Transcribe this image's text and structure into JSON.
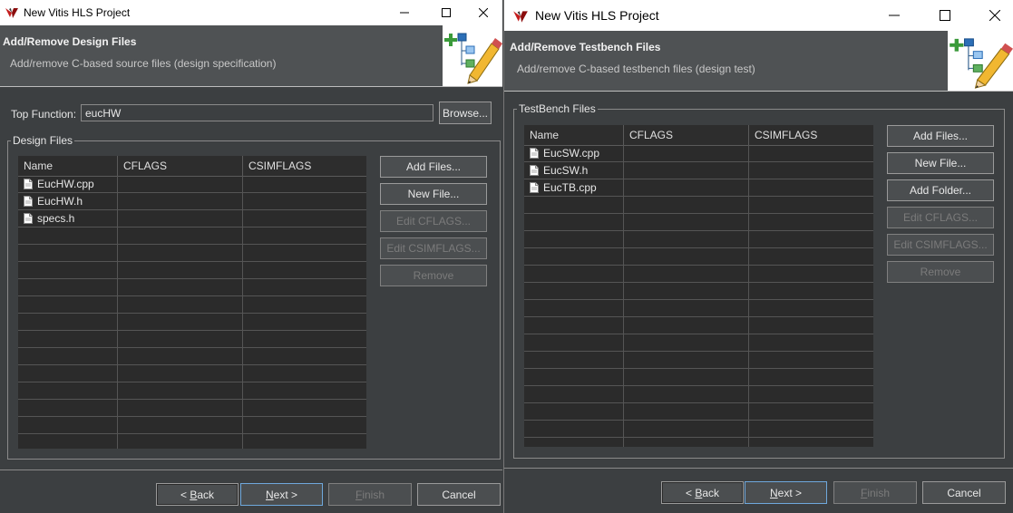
{
  "left": {
    "window_title": "New Vitis HLS Project",
    "header_title": "Add/Remove Design Files",
    "header_subtitle": "Add/remove C-based source files (design specification)",
    "top_function_label": "Top Function:",
    "top_function_value": "eucHW",
    "browse_label": "Browse...",
    "group_title": "Design Files",
    "columns": [
      "Name",
      "CFLAGS",
      "CSIMFLAGS"
    ],
    "files": [
      "EucHW.cpp",
      "EucHW.h",
      "specs.h"
    ],
    "side_buttons": {
      "add_files": "Add Files...",
      "new_file": "New File...",
      "edit_cflags": "Edit CFLAGS...",
      "edit_csimflags": "Edit CSIMFLAGS...",
      "remove": "Remove"
    },
    "nav": {
      "back_mnemonic": "B",
      "back_rest": "ack",
      "back_prefix": "< ",
      "next_mnemonic": "N",
      "next_rest": "ext >",
      "finish_mnemonic": "F",
      "finish_rest": "inish",
      "cancel": "Cancel"
    }
  },
  "right": {
    "window_title": "New Vitis HLS Project",
    "header_title": "Add/Remove Testbench Files",
    "header_subtitle": "Add/remove C-based testbench files (design test)",
    "group_title": "TestBench Files",
    "columns": [
      "Name",
      "CFLAGS",
      "CSIMFLAGS"
    ],
    "files": [
      "EucSW.cpp",
      "EucSW.h",
      "EucTB.cpp"
    ],
    "side_buttons": {
      "add_files": "Add Files...",
      "new_file": "New File...",
      "add_folder": "Add Folder...",
      "edit_cflags": "Edit CFLAGS...",
      "edit_csimflags": "Edit CSIMFLAGS...",
      "remove": "Remove"
    },
    "nav": {
      "back_mnemonic": "B",
      "back_rest": "ack",
      "back_prefix": "< ",
      "next_mnemonic": "N",
      "next_rest": "ext >",
      "finish_mnemonic": "F",
      "finish_rest": "inish",
      "cancel": "Cancel"
    }
  },
  "icons": {
    "app": "vitis-logo-icon",
    "minimize": "minimize-icon",
    "maximize": "maximize-icon",
    "close": "close-icon",
    "wizard": "wizard-pencil-icon",
    "file": "file-icon"
  },
  "colors": {
    "background": "#3c3f41",
    "header": "#4f5254",
    "table": "#2b2b2b",
    "focus": "#6fa8dc"
  }
}
